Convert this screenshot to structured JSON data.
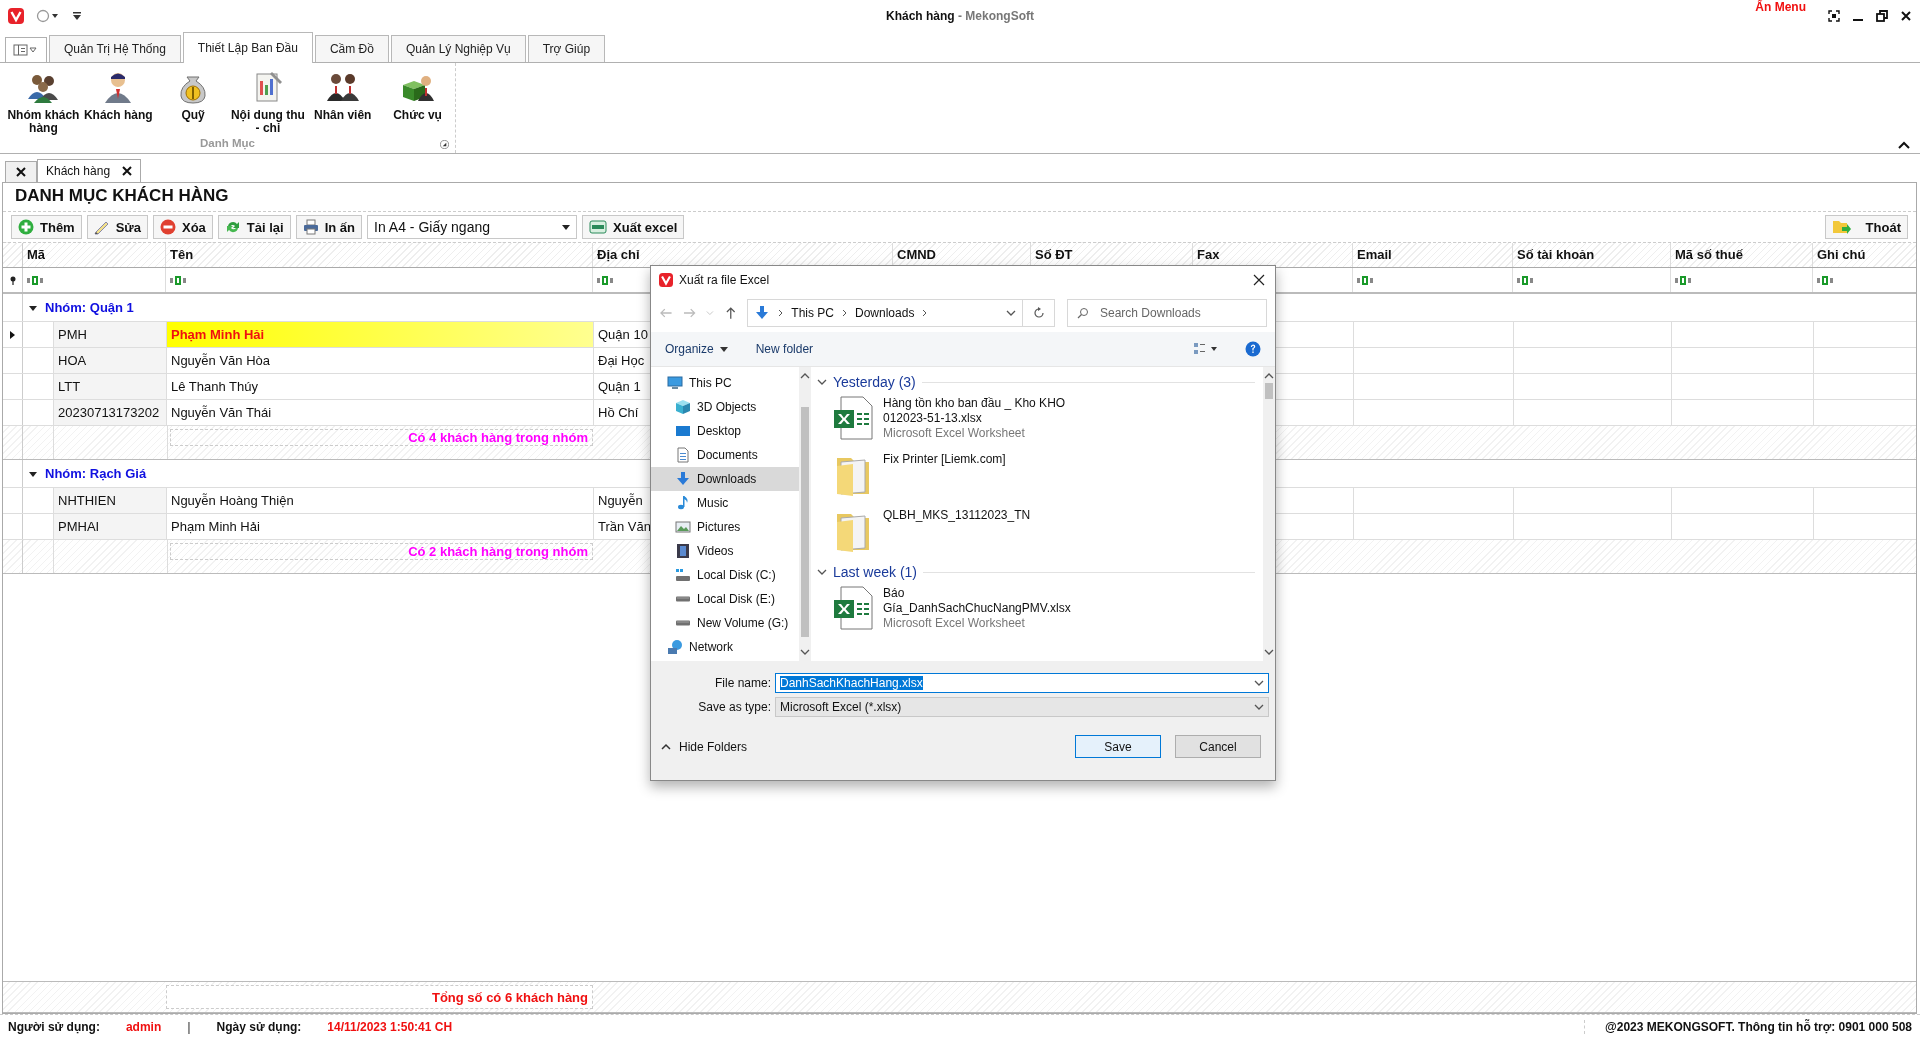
{
  "title_bar": {
    "title": "Khách hàng",
    "app_name": " - MekongSoft",
    "hide_menu": "Ẩn Menu"
  },
  "ribbon": {
    "tabs": [
      {
        "label": "Quản Trị Hệ Thống",
        "selected": false
      },
      {
        "label": "Thiết Lập Ban Đầu",
        "selected": true
      },
      {
        "label": "Cầm Đồ",
        "selected": false
      },
      {
        "label": "Quản Lý Nghiệp Vụ",
        "selected": false
      },
      {
        "label": "Trợ Giúp",
        "selected": false
      }
    ],
    "items": [
      {
        "label": "Nhóm khách hàng",
        "kind": "group"
      },
      {
        "label": "Khách hàng",
        "kind": "customer"
      },
      {
        "label": "Quỹ",
        "kind": "fund"
      },
      {
        "label": "Nội dung thu - chi",
        "kind": "ledger"
      },
      {
        "label": "Nhân viên",
        "kind": "staff"
      },
      {
        "label": "Chức vụ",
        "kind": "position"
      }
    ],
    "group_label": "Danh Mục"
  },
  "document_tabs": [
    {
      "label": "Khách hàng",
      "selected": true
    }
  ],
  "page_title": "DANH MỤC KHÁCH HÀNG",
  "toolbar": {
    "buttons": [
      {
        "label": "Thêm",
        "kind": "add"
      },
      {
        "label": "Sửa",
        "kind": "edit"
      },
      {
        "label": "Xóa",
        "kind": "delete"
      },
      {
        "label": "Tải lại",
        "kind": "reload"
      },
      {
        "label": "In ấn",
        "kind": "print"
      }
    ],
    "print_layout": "In A4 - Giấy ngang",
    "export": "Xuất excel",
    "exit": "Thoát"
  },
  "table": {
    "columns": [
      "Mã",
      "Tên",
      "Địa chỉ",
      "CMND",
      "Số ĐT",
      "Fax",
      "Email",
      "Số tài khoản",
      "Mã số thuế",
      "Ghi chú"
    ],
    "groups": [
      {
        "label": "Nhóm: Quận 1",
        "expanded": true,
        "summary": "Có 4 khách hàng trong nhóm",
        "rows": [
          {
            "code": "PMH",
            "name": "Phạm Minh Hải",
            "address": "Quận 10",
            "selected": true
          },
          {
            "code": "HOA",
            "name": "Nguyễn Văn Hòa",
            "address": "Đại Học",
            "selected": false
          },
          {
            "code": "LTT",
            "name": "Lê Thanh Thúy",
            "address": "Quận 1",
            "selected": false
          },
          {
            "code": "20230713173202",
            "name": "Nguyễn Văn Thái",
            "address": "Hồ Chí",
            "selected": false
          }
        ]
      },
      {
        "label": "Nhóm: Rạch Giá",
        "expanded": true,
        "summary": "Có 2 khách hàng trong nhóm",
        "rows": [
          {
            "code": "NHTHIEN",
            "name": "Nguyễn Hoàng Thiện",
            "address": "Nguyễn",
            "selected": false
          },
          {
            "code": "PMHAI",
            "name": "Phạm Minh Hải",
            "address": "Trần Văn",
            "selected": false
          }
        ]
      }
    ],
    "total": "Tổng số có 6 khách hàng"
  },
  "status_bar": {
    "user_label": "Người sử dụng:",
    "user": "admin",
    "separator": "|",
    "date_label": "Ngày sử dụng:",
    "date": "14/11/2023 1:50:41 CH",
    "copyright": "@2023 MEKONGSOFT. Thông tin hỗ trợ: 0901 000 508"
  },
  "dialog": {
    "title": "Xuất ra file Excel",
    "breadcrumb": [
      "This PC",
      "Downloads"
    ],
    "search_placeholder": "Search Downloads",
    "organize": "Organize",
    "new_folder": "New folder",
    "nav": [
      {
        "label": "This PC",
        "kind": "pc",
        "selected": false,
        "children": [
          {
            "label": "3D Objects",
            "kind": "cube",
            "selected": false
          },
          {
            "label": "Desktop",
            "kind": "desktop",
            "selected": false
          },
          {
            "label": "Documents",
            "kind": "documents",
            "selected": false
          },
          {
            "label": "Downloads",
            "kind": "downloads",
            "selected": true
          },
          {
            "label": "Music",
            "kind": "music",
            "selected": false
          },
          {
            "label": "Pictures",
            "kind": "pictures",
            "selected": false
          },
          {
            "label": "Videos",
            "kind": "videos",
            "selected": false
          },
          {
            "label": "Local Disk (C:)",
            "kind": "system_disk",
            "selected": false
          },
          {
            "label": "Local Disk (E:)",
            "kind": "disk",
            "selected": false
          },
          {
            "label": "New Volume (G:)",
            "kind": "disk",
            "selected": false
          }
        ]
      },
      {
        "label": "Network",
        "kind": "network",
        "selected": false
      }
    ],
    "file_groups": [
      {
        "label": "Yesterday (3)",
        "expanded": true,
        "items": [
          {
            "name": "Hàng tồn kho ban đầu _ Kho KHO 012023-51-13.xlsx",
            "type": "Microsoft Excel Worksheet",
            "kind": "excel"
          },
          {
            "name": "Fix Printer [Liemk.com]",
            "kind": "folder"
          },
          {
            "name": "QLBH_MKS_13112023_TN",
            "kind": "folder"
          }
        ]
      },
      {
        "label": "Last week (1)",
        "expanded": true,
        "items": [
          {
            "name": "Báo Gía_DanhSachChucNangPMV.xlsx",
            "type": "Microsoft Excel Worksheet",
            "kind": "excel"
          }
        ]
      }
    ],
    "file_name_label": "File name:",
    "file_name": "DanhSachKhachHang.xlsx",
    "save_type_label": "Save as type:",
    "save_type": "Microsoft Excel (*.xlsx)",
    "hide_folders": "Hide Folders",
    "save": "Save",
    "cancel": "Cancel"
  }
}
